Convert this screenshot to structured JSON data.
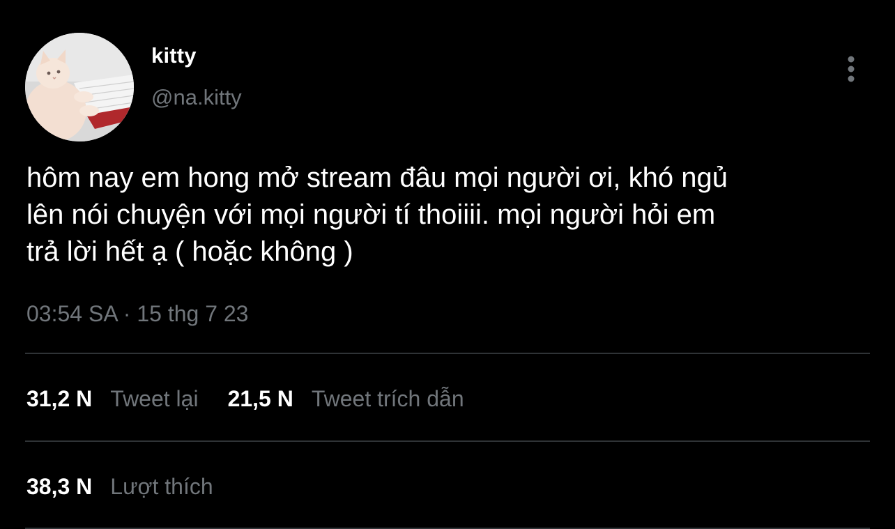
{
  "user": {
    "display_name": "kitty",
    "handle": "@na.kitty",
    "avatar_icon": "cat-avatar"
  },
  "menu": {
    "icon": "more-vertical-icon"
  },
  "tweet": {
    "text": "hôm nay em hong mở stream đâu mọi người ơi, khó ngủ\nlên nói chuyện với mọi người tí thoiiii. mọi người hỏi em\ntrả lời hết ạ ( hoặc không )",
    "time": "03:54 SA",
    "separator": "·",
    "date": "15 thg 7 23"
  },
  "stats": {
    "retweets": {
      "count": "31,2 N",
      "label": "Tweet lại"
    },
    "quotes": {
      "count": "21,5 N",
      "label": "Tweet trích dẫn"
    },
    "likes": {
      "count": "38,3 N",
      "label": "Lượt thích"
    }
  },
  "colors": {
    "background": "#000000",
    "primary_text": "#ffffff",
    "secondary_text": "#71767b",
    "divider": "#2f3336"
  }
}
